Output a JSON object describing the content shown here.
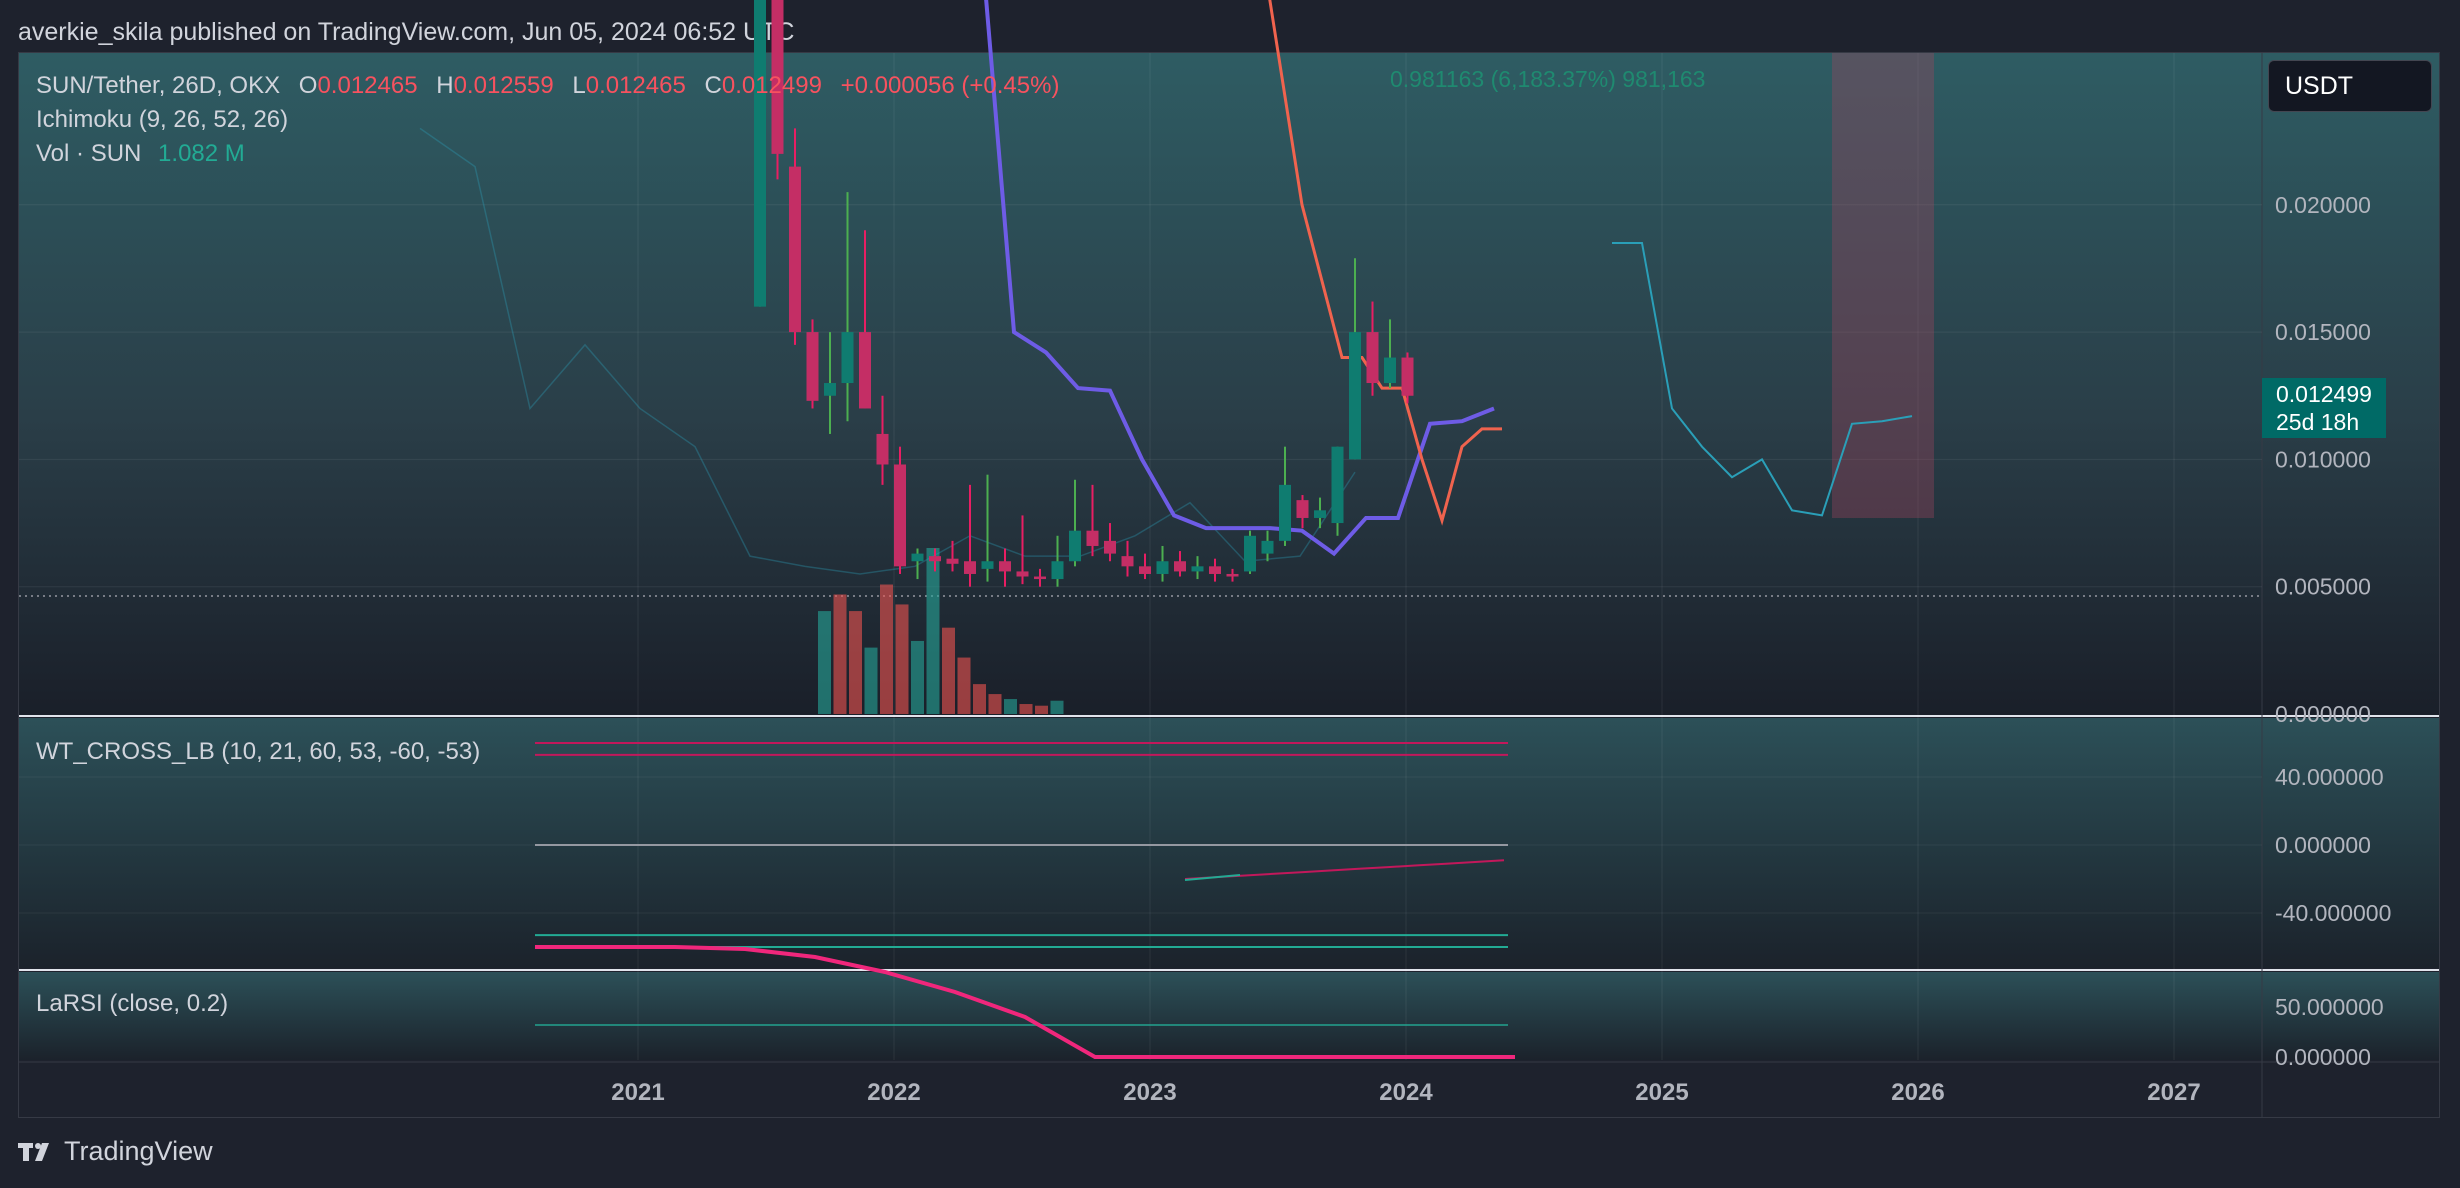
{
  "header": {
    "attribution": "averkie_skila published on TradingView.com, Jun 05, 2024 06:52 UTC"
  },
  "footer": {
    "brand": "TradingView"
  },
  "legend": {
    "symbol": "SUN/Tether, 26D, OKX",
    "open_label": "O",
    "open": "0.012465",
    "high_label": "H",
    "high": "0.012559",
    "low_label": "L",
    "low": "0.012465",
    "close_label": "C",
    "close": "0.012499",
    "change": "+0.000056 (+0.45%)",
    "ichimoku": "Ichimoku (9, 26, 52, 26)",
    "vol_label": "Vol · SUN",
    "vol_value": "1.082 M",
    "wt": "WT_CROSS_LB (10, 21, 60, 53, -60, -53)",
    "larsi": "LaRSI (close, 0.2)"
  },
  "currency_button": "USDT",
  "price_tag": {
    "price": "0.012499",
    "countdown": "25d 18h"
  },
  "measure_label": "0.981163 (6,183.37%) 981,163",
  "colors": {
    "background": "#1e222d",
    "up": "#22ab94",
    "down": "#f23645",
    "tenkan": "#6e5ce6",
    "kijun": "#f0634e",
    "lagging": "#2a9fb8",
    "larsi": "#f0277c"
  },
  "chart_data": [
    {
      "type": "candlestick",
      "title": "SUN/Tether, 26D, OKX",
      "x_axis": {
        "ticks": [
          "2021",
          "2022",
          "2023",
          "2024",
          "2025",
          "2026",
          "2027"
        ]
      },
      "y_axis": {
        "ticks": [
          "0.020000",
          "0.015000",
          "0.010000",
          "0.005000",
          "0.000000"
        ],
        "range": [
          0,
          0.0259
        ]
      },
      "candles": [
        {
          "t": "2021-07",
          "o": 0.016,
          "h": 0.029,
          "l": 0.016,
          "c": 0.029
        },
        {
          "t": "2021-12",
          "o": 0.03,
          "h": 0.03,
          "l": 0.021,
          "c": 0.022
        },
        {
          "t": "2022-01",
          "o": 0.0215,
          "h": 0.023,
          "l": 0.0145,
          "c": 0.015
        },
        {
          "t": "2022-02",
          "o": 0.015,
          "h": 0.0155,
          "l": 0.012,
          "c": 0.0123
        },
        {
          "t": "2022-03",
          "o": 0.0125,
          "h": 0.015,
          "l": 0.011,
          "c": 0.013
        },
        {
          "t": "2022-03b",
          "o": 0.013,
          "h": 0.0205,
          "l": 0.0115,
          "c": 0.015
        },
        {
          "t": "2022-04",
          "o": 0.015,
          "h": 0.019,
          "l": 0.012,
          "c": 0.012
        },
        {
          "t": "2022-05",
          "o": 0.011,
          "h": 0.0125,
          "l": 0.009,
          "c": 0.0098
        },
        {
          "t": "2022-06",
          "o": 0.0098,
          "h": 0.0105,
          "l": 0.0055,
          "c": 0.0058
        },
        {
          "t": "2022-07",
          "o": 0.006,
          "h": 0.0065,
          "l": 0.0053,
          "c": 0.0063
        },
        {
          "t": "2022-08",
          "o": 0.0062,
          "h": 0.0065,
          "l": 0.0056,
          "c": 0.006
        },
        {
          "t": "2022-09",
          "o": 0.0061,
          "h": 0.0068,
          "l": 0.0056,
          "c": 0.0059
        },
        {
          "t": "2022-10",
          "o": 0.006,
          "h": 0.009,
          "l": 0.005,
          "c": 0.0055
        },
        {
          "t": "2022-11",
          "o": 0.0057,
          "h": 0.0094,
          "l": 0.0052,
          "c": 0.006
        },
        {
          "t": "2022-11b",
          "o": 0.006,
          "h": 0.0065,
          "l": 0.005,
          "c": 0.0056
        },
        {
          "t": "2022-12",
          "o": 0.0056,
          "h": 0.0078,
          "l": 0.0051,
          "c": 0.0054
        },
        {
          "t": "2023-01",
          "o": 0.0054,
          "h": 0.0057,
          "l": 0.005,
          "c": 0.0053
        },
        {
          "t": "2023-02",
          "o": 0.0053,
          "h": 0.007,
          "l": 0.005,
          "c": 0.006
        },
        {
          "t": "2023-03",
          "o": 0.006,
          "h": 0.0092,
          "l": 0.0058,
          "c": 0.0072
        },
        {
          "t": "2023-04",
          "o": 0.0072,
          "h": 0.009,
          "l": 0.0062,
          "c": 0.0066
        },
        {
          "t": "2023-05",
          "o": 0.0068,
          "h": 0.0075,
          "l": 0.006,
          "c": 0.0063
        },
        {
          "t": "2023-06",
          "o": 0.0062,
          "h": 0.0068,
          "l": 0.0054,
          "c": 0.0058
        },
        {
          "t": "2023-07",
          "o": 0.0058,
          "h": 0.0063,
          "l": 0.0053,
          "c": 0.0055
        },
        {
          "t": "2023-08",
          "o": 0.0055,
          "h": 0.0066,
          "l": 0.0052,
          "c": 0.006
        },
        {
          "t": "2023-09",
          "o": 0.006,
          "h": 0.0064,
          "l": 0.0054,
          "c": 0.0056
        },
        {
          "t": "2023-10",
          "o": 0.0056,
          "h": 0.0062,
          "l": 0.0053,
          "c": 0.0058
        },
        {
          "t": "2023-10b",
          "o": 0.0058,
          "h": 0.0061,
          "l": 0.0052,
          "c": 0.0055
        },
        {
          "t": "2023-11",
          "o": 0.0055,
          "h": 0.0057,
          "l": 0.0052,
          "c": 0.0054
        },
        {
          "t": "2023-12",
          "o": 0.0056,
          "h": 0.0072,
          "l": 0.0055,
          "c": 0.007
        },
        {
          "t": "2024-01",
          "o": 0.0063,
          "h": 0.0072,
          "l": 0.006,
          "c": 0.0068
        },
        {
          "t": "2024-02",
          "o": 0.0068,
          "h": 0.0105,
          "l": 0.0066,
          "c": 0.009
        },
        {
          "t": "2024-02b",
          "o": 0.0084,
          "h": 0.0086,
          "l": 0.0073,
          "c": 0.0077
        },
        {
          "t": "2024-03",
          "o": 0.0077,
          "h": 0.0085,
          "l": 0.0073,
          "c": 0.008
        },
        {
          "t": "2024-03b",
          "o": 0.0075,
          "h": 0.0105,
          "l": 0.007,
          "c": 0.0105
        },
        {
          "t": "2024-04",
          "o": 0.01,
          "h": 0.0179,
          "l": 0.01,
          "c": 0.015
        },
        {
          "t": "2024-04b",
          "o": 0.015,
          "h": 0.0162,
          "l": 0.0125,
          "c": 0.013
        },
        {
          "t": "2024-05",
          "o": 0.013,
          "h": 0.0155,
          "l": 0.0128,
          "c": 0.014
        },
        {
          "t": "2024-06",
          "o": 0.014,
          "h": 0.0142,
          "l": 0.0122,
          "c": 0.0125
        }
      ],
      "volume": {
        "series_name": "Vol · SUN",
        "last": "1.082 M",
        "bars": [
          {
            "dir": "up",
            "v": 0.62
          },
          {
            "dir": "down",
            "v": 0.72
          },
          {
            "dir": "down",
            "v": 0.62
          },
          {
            "dir": "up",
            "v": 0.4
          },
          {
            "dir": "down",
            "v": 0.78
          },
          {
            "dir": "down",
            "v": 0.66
          },
          {
            "dir": "up",
            "v": 0.44
          },
          {
            "dir": "up",
            "v": 1.0
          },
          {
            "dir": "down",
            "v": 0.52
          },
          {
            "dir": "down",
            "v": 0.34
          },
          {
            "dir": "down",
            "v": 0.18
          },
          {
            "dir": "down",
            "v": 0.12
          },
          {
            "dir": "up",
            "v": 0.09
          },
          {
            "dir": "down",
            "v": 0.06
          },
          {
            "dir": "down",
            "v": 0.05
          },
          {
            "dir": "up",
            "v": 0.08
          }
        ]
      },
      "ichimoku": {
        "params": "9, 26, 52, 26",
        "tenkan": [
          0.03,
          0.015,
          0.0142,
          0.0128,
          0.0127,
          0.01,
          0.0078,
          0.0073,
          0.0073,
          0.0073,
          0.0072,
          0.0063,
          0.0077,
          0.0077,
          0.0114,
          0.0115,
          0.012
        ],
        "kijun": [
          0.03,
          0.025,
          0.02,
          0.017,
          0.014,
          0.014,
          0.0128,
          0.0128,
          0.01,
          0.0076,
          0.0105,
          0.0112,
          0.0112
        ],
        "lagging_span": [
          0.023,
          0.0215,
          0.012,
          0.0145,
          0.012,
          0.0105,
          0.0062,
          0.0058,
          0.0055,
          0.0058,
          0.007,
          0.0062,
          0.0062,
          0.007,
          0.0083,
          0.006,
          0.0062,
          0.0095
        ],
        "future_lagging": [
          0.0185,
          0.0185,
          0.012,
          0.0105,
          0.0093,
          0.01,
          0.008,
          0.0078,
          0.0114,
          0.0115,
          0.0117
        ]
      }
    },
    {
      "type": "line",
      "title": "WT_CROSS_LB (10, 21, 60, 53, -60, -53)",
      "y_axis": {
        "ticks": [
          "40.000000",
          "0.000000",
          "-40.000000"
        ]
      },
      "reference_levels": [
        60,
        53,
        -53,
        -60,
        0
      ],
      "series": [
        {
          "values": [
            -20,
            -19,
            -18,
            -17,
            -16,
            -15,
            -14,
            -13,
            -12,
            -11,
            -10,
            -9
          ]
        }
      ]
    },
    {
      "type": "line",
      "title": "LaRSI (close, 0.2)",
      "y_axis": {
        "ticks": [
          "50.000000",
          "0.000000"
        ]
      },
      "reference_levels": [
        20
      ],
      "series": [
        {
          "values": [
            80,
            80,
            80,
            78,
            70,
            55,
            35,
            10,
            0,
            0,
            0,
            0,
            0,
            0,
            0
          ]
        }
      ]
    }
  ]
}
